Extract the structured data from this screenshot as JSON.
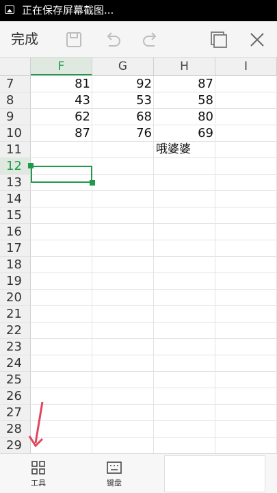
{
  "status_bar": {
    "text": "正在保存屏幕截图...",
    "icon": "image-icon"
  },
  "toolbar": {
    "done_label": "完成",
    "icons": [
      "save-icon",
      "undo-icon",
      "redo-icon",
      "sheets-icon",
      "close-icon"
    ],
    "sheet_count": "2"
  },
  "grid": {
    "columns": [
      "F",
      "G",
      "H",
      "I"
    ],
    "active_column": "F",
    "active_row": "12",
    "rows": [
      {
        "num": "7",
        "F": "81",
        "G": "92",
        "H": "87"
      },
      {
        "num": "8",
        "F": "43",
        "G": "53",
        "H": "58"
      },
      {
        "num": "9",
        "F": "62",
        "G": "68",
        "H": "80"
      },
      {
        "num": "10",
        "F": "87",
        "G": "76",
        "H": "69"
      },
      {
        "num": "11",
        "F": "",
        "G": "",
        "H": "哦婆婆"
      },
      {
        "num": "12"
      },
      {
        "num": "13"
      },
      {
        "num": "14"
      },
      {
        "num": "15"
      },
      {
        "num": "16"
      },
      {
        "num": "17"
      },
      {
        "num": "18"
      },
      {
        "num": "19"
      },
      {
        "num": "20"
      },
      {
        "num": "21"
      },
      {
        "num": "22"
      },
      {
        "num": "23"
      },
      {
        "num": "24"
      },
      {
        "num": "25"
      },
      {
        "num": "26"
      },
      {
        "num": "27"
      },
      {
        "num": "28"
      },
      {
        "num": "29"
      }
    ]
  },
  "bottom_bar": {
    "tools_label": "工具",
    "keyboard_label": "键盘"
  },
  "colors": {
    "accent": "#1f9a4a",
    "arrow": "#e0475f"
  }
}
